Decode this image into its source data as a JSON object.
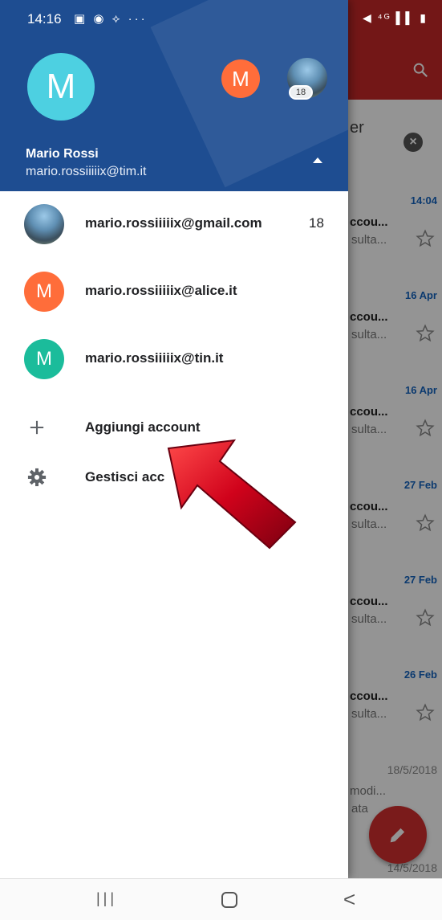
{
  "status_bar": {
    "time": "14:16",
    "left_icons": "▣ ◉ ⟡ ···",
    "right_icons": "◀ ⁴ᴳ ▌▌ ▮"
  },
  "inbox": {
    "filter_partial": "er",
    "rows": [
      {
        "date": "14:04",
        "sender": "ccou...",
        "snippet": "sulta...",
        "grey": false
      },
      {
        "date": "16 Apr",
        "sender": "ccou...",
        "snippet": "sulta...",
        "grey": false
      },
      {
        "date": "16 Apr",
        "sender": "ccou...",
        "snippet": "sulta...",
        "grey": false
      },
      {
        "date": "27 Feb",
        "sender": "ccou...",
        "snippet": "sulta...",
        "grey": false
      },
      {
        "date": "27 Feb",
        "sender": "ccou...",
        "snippet": "sulta...",
        "grey": false
      },
      {
        "date": "26 Feb",
        "sender": "ccou...",
        "snippet": "sulta...",
        "grey": false
      },
      {
        "date": "18/5/2018",
        "sender": "modi...",
        "snippet": "ata",
        "grey": true
      }
    ],
    "last_row_date": "14/5/2018"
  },
  "drawer": {
    "header": {
      "avatar_letter": "M",
      "small_avatar_letter": "M",
      "photo_badge": "18",
      "name": "Mario Rossi",
      "email": "mario.rossiiiiix@tim.it"
    },
    "accounts": [
      {
        "email": "mario.rossiiiiix@gmail.com",
        "count": "18",
        "avatar_type": "photo",
        "letter": "",
        "color": ""
      },
      {
        "email": "mario.rossiiiiix@alice.it",
        "count": "",
        "avatar_type": "letter",
        "letter": "M",
        "color": "#ff6d3a"
      },
      {
        "email": "mario.rossiiiiix@tin.it",
        "count": "",
        "avatar_type": "letter",
        "letter": "M",
        "color": "#1bbc9b"
      }
    ],
    "menu": {
      "add_account": "Aggiungi account",
      "manage_accounts": "Gestisci acc"
    }
  },
  "colors": {
    "header_blue": "#1e4d91",
    "toolbar_red": "#c62828",
    "date_blue": "#1565c0",
    "arrow_red": "#d0021b"
  },
  "nav_bar": {
    "recent": "|||",
    "back": "<"
  }
}
